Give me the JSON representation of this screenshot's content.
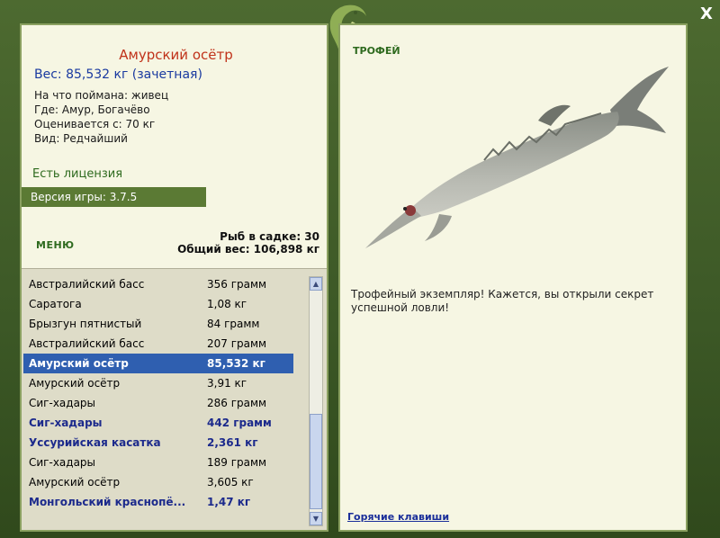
{
  "window": {
    "close_label": "X"
  },
  "fish": {
    "name": "Амурский осётр",
    "weight_line": "Вес: 85,532 кг (зачетная)",
    "bait_line": "На что поймана: живец",
    "place_line": "Где: Амур, Богачёво",
    "valued_line": "Оценивается с: 70 кг",
    "kind_line": "Вид: Редчайший"
  },
  "license": "Есть лицензия",
  "version": "Версия игры: 3.7.5",
  "menu_label": "МЕНЮ",
  "keepnet": {
    "count_line": "Рыб в садке: 30",
    "total_line": "Общий вес: 106,898 кг"
  },
  "catch_list": [
    {
      "name": "Австралийский басс",
      "weight": "356 грамм",
      "style": "normal"
    },
    {
      "name": "Саратога",
      "weight": "1,08 кг",
      "style": "normal"
    },
    {
      "name": "Брызгун пятнистый",
      "weight": "84 грамм",
      "style": "normal"
    },
    {
      "name": "Австралийский басс",
      "weight": "207 грамм",
      "style": "normal"
    },
    {
      "name": "Амурский осётр",
      "weight": "85,532 кг",
      "style": "selected"
    },
    {
      "name": "Амурский осётр",
      "weight": "3,91 кг",
      "style": "normal"
    },
    {
      "name": "Сиг-хадары",
      "weight": "286 грамм",
      "style": "normal"
    },
    {
      "name": "Сиг-хадары",
      "weight": "442 грамм",
      "style": "bold"
    },
    {
      "name": "Уссурийская касатка",
      "weight": "2,361 кг",
      "style": "bold"
    },
    {
      "name": "Сиг-хадары",
      "weight": "189 грамм",
      "style": "normal"
    },
    {
      "name": "Амурский осётр",
      "weight": "3,605 кг",
      "style": "normal"
    },
    {
      "name": "Монгольский краснопё...",
      "weight": "1,47 кг",
      "style": "bold"
    }
  ],
  "trophy": {
    "label": "ТРОФЕЙ",
    "description": "Трофейный экземпляр! Кажется, вы открыли секрет успешной ловли!"
  },
  "hotkeys_label": "Горячие клавиши",
  "icons": [
    "close-icon",
    "fish-logo-icon",
    "scroll-up-icon",
    "scroll-down-icon",
    "trophy-fish-image"
  ],
  "colors": {
    "panel_bg": "#f6f6e3",
    "frame_green": "#5b7a34",
    "selected_row": "#2f5fb0",
    "title_red": "#c0321a"
  }
}
